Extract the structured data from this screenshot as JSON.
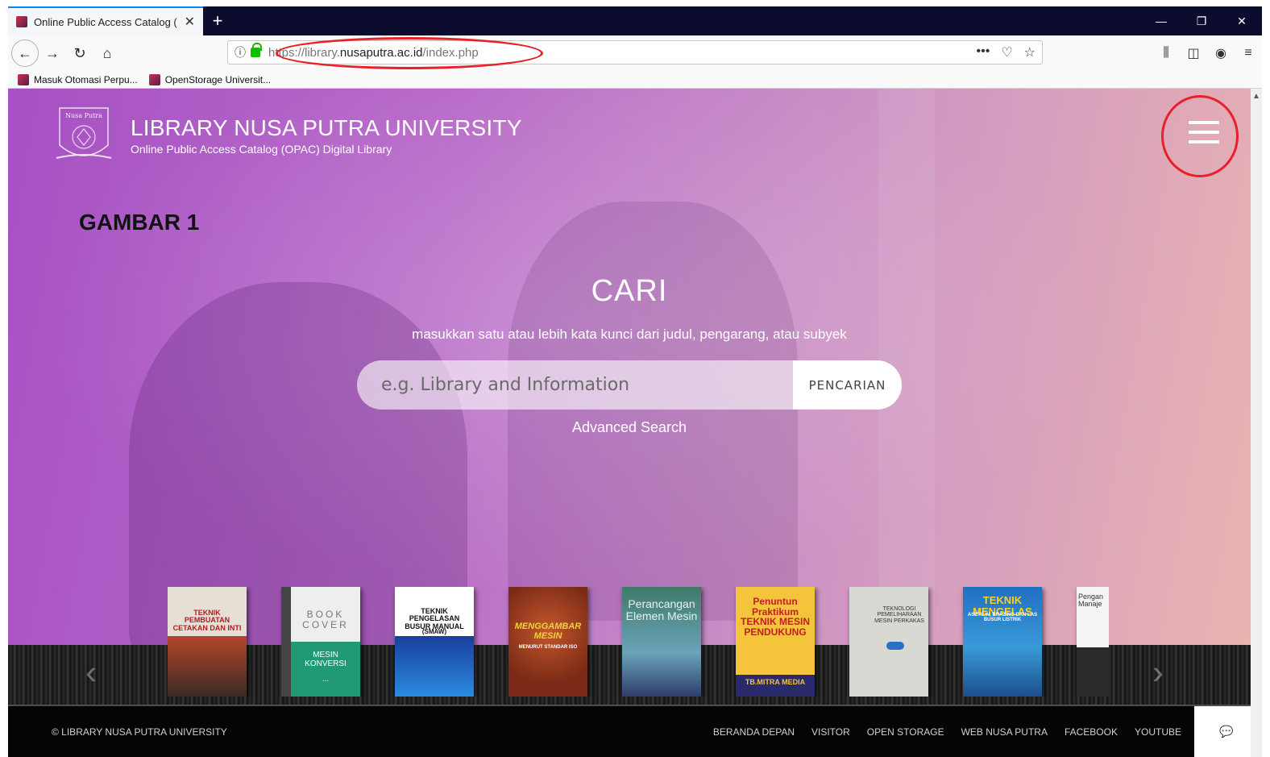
{
  "browser": {
    "tab_title": "Online Public Access Catalog (",
    "url_prefix": "https://library.",
    "url_domain": "nusaputra.ac.id",
    "url_path": "/index.php",
    "bookmarks": [
      "Masuk Otomasi Perpu...",
      "OpenStorage Universit..."
    ]
  },
  "header": {
    "seal_text": "Nusa Putra",
    "title": "LIBRARY NUSA PUTRA UNIVERSITY",
    "subtitle": "Online Public Access Catalog (OPAC) Digital Library"
  },
  "annotation": {
    "label": "GAMBAR 1"
  },
  "search": {
    "heading": "CARI",
    "hint": "masukkan satu atau lebih kata kunci dari judul, pengarang, atau subyek",
    "placeholder": "e.g. Library and Information",
    "button": "PENCARIAN",
    "advanced": "Advanced Search"
  },
  "books": [
    {
      "title": "TEKNIK PEMBUATAN CETAKAN DAN INTI",
      "color": "#e6dfd6"
    },
    {
      "title": "BOOK COVER",
      "subtitle": "MESIN KONVERSI",
      "extra": "...",
      "color": "#f2f2f2"
    },
    {
      "title": "TEKNIK PENGELASAN BUSUR MANUAL",
      "subtitle": "(SMAW)",
      "color": "#ffffff"
    },
    {
      "title": "MENGGAMBAR MESIN",
      "subtitle": "MENURUT STANDAR ISO",
      "color": "#8c3a1e"
    },
    {
      "title": "Perancangan Elemen Mesin",
      "color": "#3f7a6a"
    },
    {
      "title": "Penuntun Praktikum TEKNIK MESIN PENDUKUNG",
      "subtitle": "TB.MITRA MEDIA",
      "color": "#f3c43c"
    },
    {
      "title": "TEKNOLOGI PEMELIHARAAN MESIN PERKAKAS",
      "color": "#d9d9d4"
    },
    {
      "title": "TEKNIK MENGELAS",
      "subtitle": "ASETILIN, BRAZING DAN LAS BUSUR LISTRIK",
      "color": "#1f6fc2"
    },
    {
      "title": "Pengan Manaje",
      "color": "#f4f4f4"
    }
  ],
  "footer": {
    "copyright": "© LIBRARY NUSA PUTRA UNIVERSITY",
    "links": [
      "BERANDA DEPAN",
      "VISITOR",
      "OPEN STORAGE",
      "WEB NUSA PUTRA",
      "FACEBOOK",
      "YOUTUBE"
    ]
  },
  "colors": {
    "annotation_ring": "#e8202a",
    "hero_start": "#a651c4",
    "hero_end": "#e8b4b0"
  }
}
